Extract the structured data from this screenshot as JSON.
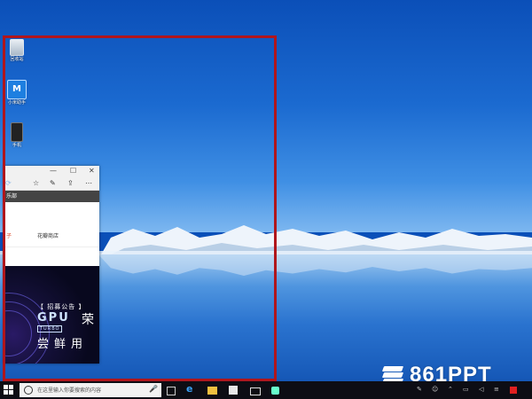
{
  "desktop": {
    "icons": [
      {
        "name": "recycle-bin",
        "label": "回收站"
      },
      {
        "name": "mi-app",
        "label": "小米助手"
      },
      {
        "name": "phone-app",
        "label": "手机"
      }
    ]
  },
  "edge_window": {
    "title_controls": {
      "minimize": "—",
      "maximize": "☐",
      "close": "✕"
    },
    "dark_bar_text": "乐部",
    "nav_left": "子",
    "nav_store": "花瓣商店",
    "banner": {
      "notice": "【 招募公告 】",
      "gpu": "GPU",
      "turbo": "TURBO",
      "side_char": "荣",
      "taste": "尝鲜用"
    }
  },
  "watermark": {
    "text": "861PPT"
  },
  "taskbar": {
    "search_placeholder": "在这里输入你要搜索的内容",
    "mic_icon": "mic-icon"
  },
  "colors": {
    "highlight": "#b0161c",
    "taskbar": "#0d0d14",
    "edge_accent": "#1e7fe0"
  }
}
